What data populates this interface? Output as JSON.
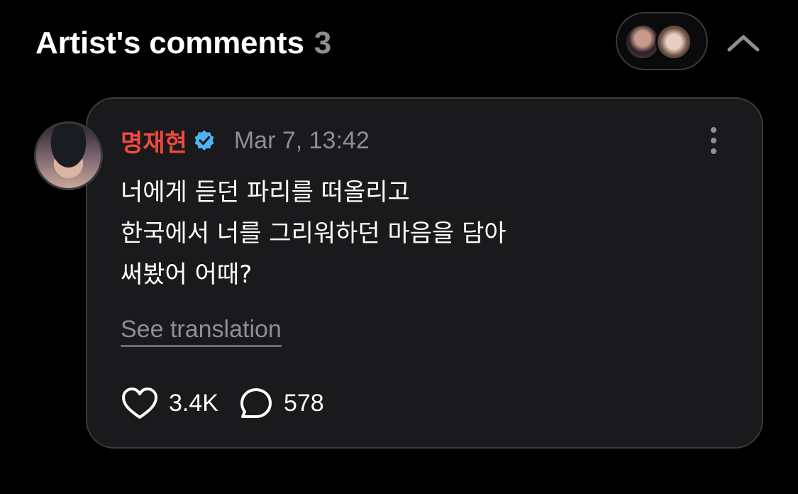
{
  "header": {
    "title": "Artist's comments",
    "count": "3"
  },
  "comment": {
    "author": "명재현",
    "timestamp": "Mar 7, 13:42",
    "lines": [
      "너에게 듣던 파리를 떠올리고",
      "한국에서 너를 그리워하던 마음을 담아",
      "써봤어 어때?"
    ],
    "see_translation": "See translation",
    "likes": "3.4K",
    "replies": "578"
  },
  "colors": {
    "background": "#000000",
    "card": "#1a1a1c",
    "author_name": "#f2493d",
    "verified": "#4fb3f0",
    "muted": "#8e8e93"
  },
  "icons": {
    "verified": "verified-badge-icon",
    "more": "more-vertical-icon",
    "like": "heart-icon",
    "reply": "speech-bubble-icon",
    "collapse": "chevron-up-icon"
  }
}
